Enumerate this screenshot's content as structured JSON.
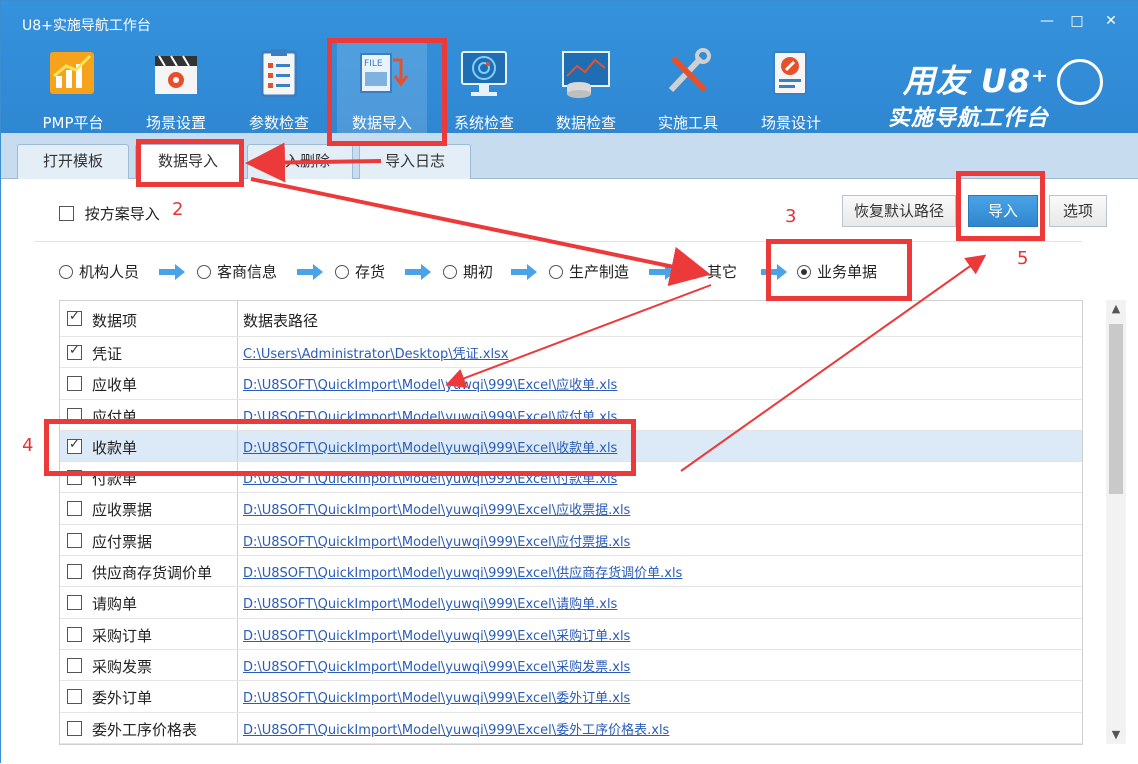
{
  "window": {
    "title": "U8+实施导航工作台",
    "controls": [
      "—",
      "□",
      "✕"
    ]
  },
  "toolbar": {
    "items": [
      {
        "label": "PMP平台",
        "icon": "pmp-chart-icon"
      },
      {
        "label": "场景设置",
        "icon": "scene-settings-icon"
      },
      {
        "label": "参数检查",
        "icon": "clipboard-check-icon"
      },
      {
        "label": "数据导入",
        "icon": "file-import-icon",
        "active": true
      },
      {
        "label": "系统检查",
        "icon": "monitor-radar-icon"
      },
      {
        "label": "数据检查",
        "icon": "database-chart-icon"
      },
      {
        "label": "实施工具",
        "icon": "tools-icon"
      },
      {
        "label": "场景设计",
        "icon": "scene-design-icon"
      }
    ]
  },
  "brand": {
    "line1": "用友 U8⁺",
    "line2": "实施导航工作台"
  },
  "tabs": [
    {
      "label": "打开模板"
    },
    {
      "label": "数据导入",
      "active": true
    },
    {
      "label": "导入删除"
    },
    {
      "label": "导入日志"
    }
  ],
  "options": {
    "by_plan_label": "按方案导入",
    "by_plan_checked": false
  },
  "buttons": {
    "restore_default": "恢复默认路径",
    "import": "导入",
    "options": "选项"
  },
  "steps": [
    {
      "label": "机构人员",
      "selected": false
    },
    {
      "label": "客商信息",
      "selected": false
    },
    {
      "label": "存货",
      "selected": false
    },
    {
      "label": "期初",
      "selected": false
    },
    {
      "label": "生产制造",
      "selected": false
    },
    {
      "label": "其它",
      "selected": false
    },
    {
      "label": "业务单据",
      "selected": true
    }
  ],
  "table": {
    "columns": [
      "数据项",
      "数据表路径"
    ],
    "header_checked": true,
    "rows": [
      {
        "name": "凭证",
        "path": "C:\\Users\\Administrator\\Desktop\\凭证.xlsx",
        "checked": true,
        "selected": false
      },
      {
        "name": "应收单",
        "path": "D:\\U8SOFT\\QuickImport\\Model\\yuwqi\\999\\Excel\\应收单.xls",
        "checked": false,
        "selected": false
      },
      {
        "name": "应付单",
        "path": "D:\\U8SOFT\\QuickImport\\Model\\yuwqi\\999\\Excel\\应付单.xls",
        "checked": false,
        "selected": false
      },
      {
        "name": "收款单",
        "path": "D:\\U8SOFT\\QuickImport\\Model\\yuwqi\\999\\Excel\\收款单.xls",
        "checked": true,
        "selected": true
      },
      {
        "name": "付款单",
        "path": "D:\\U8SOFT\\QuickImport\\Model\\yuwqi\\999\\Excel\\付款单.xls",
        "checked": false,
        "selected": false
      },
      {
        "name": "应收票据",
        "path": "D:\\U8SOFT\\QuickImport\\Model\\yuwqi\\999\\Excel\\应收票据.xls",
        "checked": false,
        "selected": false
      },
      {
        "name": "应付票据",
        "path": "D:\\U8SOFT\\QuickImport\\Model\\yuwqi\\999\\Excel\\应付票据.xls",
        "checked": false,
        "selected": false
      },
      {
        "name": "供应商存货调价单",
        "path": "D:\\U8SOFT\\QuickImport\\Model\\yuwqi\\999\\Excel\\供应商存货调价单.xls",
        "checked": false,
        "selected": false
      },
      {
        "name": "请购单",
        "path": "D:\\U8SOFT\\QuickImport\\Model\\yuwqi\\999\\Excel\\请购单.xls",
        "checked": false,
        "selected": false
      },
      {
        "name": "采购订单",
        "path": "D:\\U8SOFT\\QuickImport\\Model\\yuwqi\\999\\Excel\\采购订单.xls",
        "checked": false,
        "selected": false
      },
      {
        "name": "采购发票",
        "path": "D:\\U8SOFT\\QuickImport\\Model\\yuwqi\\999\\Excel\\采购发票.xls",
        "checked": false,
        "selected": false
      },
      {
        "name": "委外订单",
        "path": "D:\\U8SOFT\\QuickImport\\Model\\yuwqi\\999\\Excel\\委外订单.xls",
        "checked": false,
        "selected": false
      },
      {
        "name": "委外工序价格表",
        "path": "D:\\U8SOFT\\QuickImport\\Model\\yuwqi\\999\\Excel\\委外工序价格表.xls",
        "checked": false,
        "selected": false
      }
    ]
  },
  "annotations": {
    "n2": "2",
    "n3": "3",
    "n4": "4",
    "n5": "5",
    "color": "#ec3a3a"
  },
  "colors": {
    "titlebar": "#3592dc",
    "tabstrip": "#c7ddef",
    "primary_button": "#2f86cf",
    "link": "#2a5cb8",
    "selected_row": "#dce9f7"
  }
}
